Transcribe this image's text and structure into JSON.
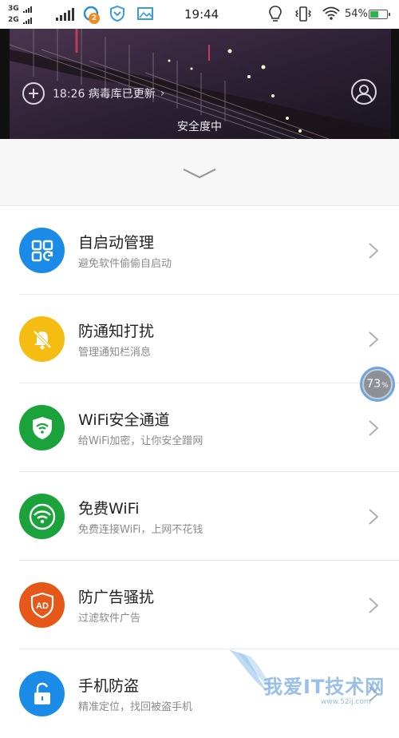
{
  "status_bar": {
    "network_1": "3G",
    "network_2": "2G",
    "notification_badge": "2",
    "time": "19:44",
    "battery_percent": "54%",
    "battery_level": 0.54,
    "icons": [
      "signal-icon",
      "qq-icon",
      "shield-app-icon",
      "gallery-icon",
      "bulb-icon",
      "vibrate-icon",
      "wifi-icon",
      "battery-icon"
    ]
  },
  "header": {
    "update_text": "18:26 病毒库已更新",
    "status_text": "安全度中"
  },
  "features": [
    {
      "title": "自启动管理",
      "subtitle": "避免软件偷偷自启动",
      "icon": "grid-refresh-icon",
      "color": "#1a8be6"
    },
    {
      "title": "防通知打扰",
      "subtitle": "管理通知栏消息",
      "icon": "bell-mute-icon",
      "color": "#f5bd12"
    },
    {
      "title": "WiFi安全通道",
      "subtitle": "给WiFi加密，让你安全蹭网",
      "icon": "wifi-shield-icon",
      "color": "#1aa33a"
    },
    {
      "title": "免费WiFi",
      "subtitle": "免费连接WiFi，上网不花钱",
      "icon": "wifi-icon",
      "color": "#1aa33a"
    },
    {
      "title": "防广告骚扰",
      "subtitle": "过滤软件广告",
      "icon": "ad-shield-icon",
      "color": "#e5581a"
    },
    {
      "title": "手机防盗",
      "subtitle": "精准定位，找回被盗手机",
      "icon": "lock-icon",
      "color": "#1a8be6"
    }
  ],
  "floating_widget": {
    "value": "73",
    "unit": "%"
  },
  "watermark": {
    "text": "我爱IT技术网",
    "url": "www.52ij.com"
  }
}
